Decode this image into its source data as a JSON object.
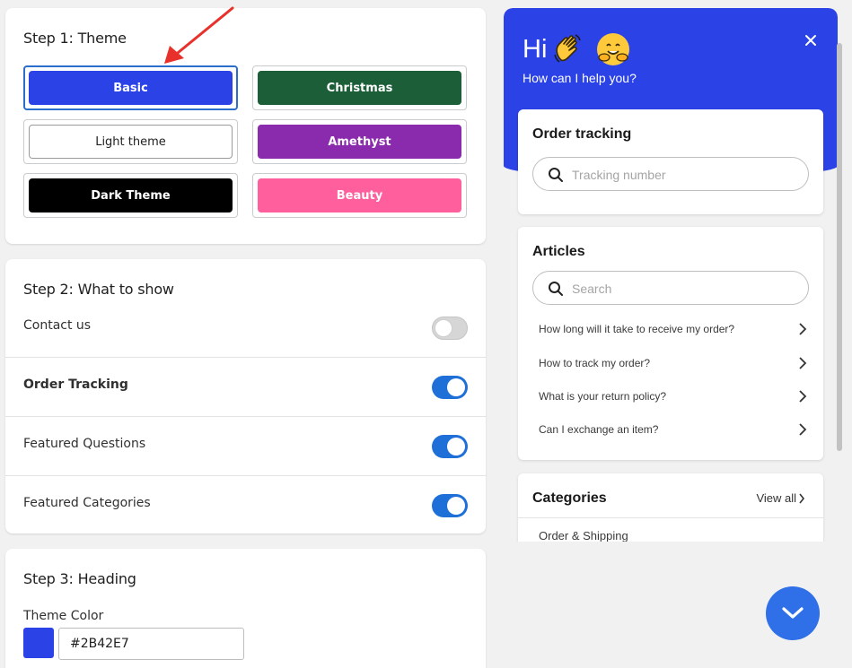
{
  "colors": {
    "brand": "#2B42E7",
    "christmas": "#1B5E37",
    "amethyst": "#8A2BAE",
    "dark": "#000000",
    "beauty": "#FF5F9C",
    "toggle_on": "#1F6FD8",
    "fab": "#2F6FE8"
  },
  "step1": {
    "title": "Step 1: Theme",
    "themes": [
      {
        "label": "Basic",
        "selected": true
      },
      {
        "label": "Christmas",
        "selected": false
      },
      {
        "label": "Light theme",
        "selected": false
      },
      {
        "label": "Amethyst",
        "selected": false
      },
      {
        "label": "Dark Theme",
        "selected": false
      },
      {
        "label": "Beauty",
        "selected": false
      }
    ]
  },
  "step2": {
    "title": "Step 2: What to show",
    "toggles": [
      {
        "label": "Contact us",
        "on": false
      },
      {
        "label": "Order Tracking",
        "on": true
      },
      {
        "label": "Featured Questions",
        "on": true
      },
      {
        "label": "Featured Categories",
        "on": true
      }
    ]
  },
  "step3": {
    "title": "Step 3: Heading",
    "color_label": "Theme Color",
    "color_value": "#2B42E7"
  },
  "preview": {
    "greeting": "Hi",
    "subtitle": "How can I help you?",
    "order_tracking": {
      "title": "Order tracking",
      "placeholder": "Tracking number"
    },
    "articles": {
      "title": "Articles",
      "placeholder": "Search",
      "items": [
        "How long will it take to receive my order?",
        "How to track my order?",
        "What is your return policy?",
        "Can I exchange an item?"
      ]
    },
    "categories": {
      "title": "Categories",
      "view_all": "View all",
      "items": [
        "Order & Shipping"
      ]
    }
  },
  "icons": {
    "close": "close-icon",
    "search": "search-icon",
    "chevron": "chevron-right-icon",
    "fab": "chevron-down-icon",
    "annotation": "red-arrow"
  }
}
